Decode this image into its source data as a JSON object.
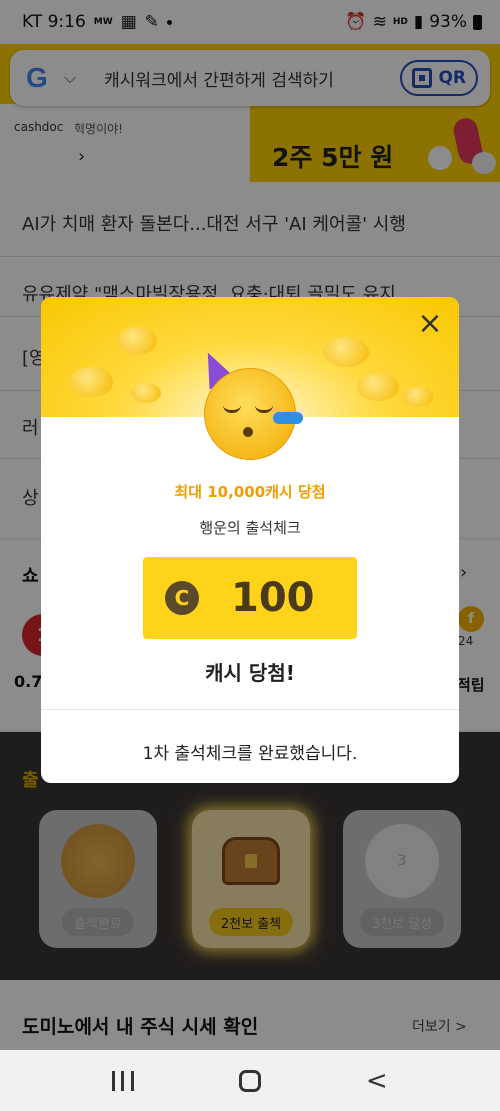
{
  "status_bar": {
    "carrier_time": "KT 9:16",
    "mw": "MW",
    "battery": "93%",
    "hd": "HD"
  },
  "search": {
    "engine": "G",
    "placeholder": "캐시워크에서 간편하게 검색하기",
    "qr_label": "QR"
  },
  "banner": {
    "brand": "cashdoc",
    "sub": "혁명이야!",
    "title": "2주 5만 원"
  },
  "news": [
    "AI가 치매 환자 돌본다...대전 서구 'AI 케어콜' 시행",
    "유유제약 \"맥스마빌장용정, 요충·대퇴 골밀도 유지",
    "[영",
    "러",
    "상"
  ],
  "shopping": {
    "title": "쇼",
    "avatar_text": "1",
    "value": "0.7",
    "right_badge": "f",
    "right_text": "24",
    "right_label": "적립"
  },
  "attendance": {
    "title": "출",
    "right": "!",
    "cards": [
      {
        "label": "출첵완료",
        "center": ""
      },
      {
        "label": "2천보 출첵",
        "center": ""
      },
      {
        "label": "3천보 달성",
        "center": "3"
      }
    ]
  },
  "domino": {
    "title": "도미노에서 내 주식 시세 확인",
    "more": "더보기 >"
  },
  "modal": {
    "close": "×",
    "highlight": "최대 10,000캐시 당첨",
    "sub": "행운의 출석체크",
    "cash_icon": "C",
    "amount": "100",
    "win": "캐시 당첨!",
    "footer": "1차 출석체크를 완료했습니다."
  },
  "nav": {
    "back": "<"
  }
}
